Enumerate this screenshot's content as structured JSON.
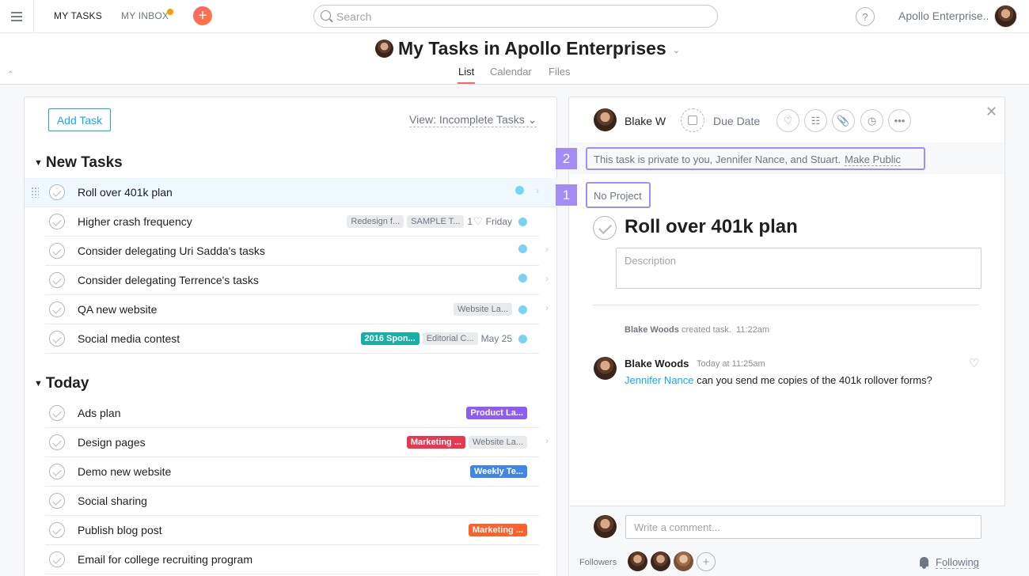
{
  "topbar": {
    "my_tasks": "MY TASKS",
    "my_inbox": "MY INBOX",
    "search_placeholder": "Search",
    "help": "?",
    "workspace": "Apollo Enterprise.."
  },
  "header": {
    "title": "My Tasks in Apollo Enterprises",
    "tabs": {
      "list": "List",
      "calendar": "Calendar",
      "files": "Files"
    }
  },
  "left": {
    "add_task": "Add Task",
    "view_filter": "View: Incomplete Tasks",
    "sections": [
      {
        "title": "New Tasks",
        "tasks": [
          {
            "name": "Roll over 401k plan",
            "tags": [],
            "selected": true,
            "chevron": true,
            "dot": true
          },
          {
            "name": "Higher crash frequency",
            "tags": [
              {
                "text": "Redesign f..."
              },
              {
                "text": "SAMPLE T..."
              }
            ],
            "likes": "1",
            "due": "Friday",
            "dot": true
          },
          {
            "name": "Consider delegating Uri Sadda's tasks",
            "tags": [],
            "chevron": true,
            "dot": true
          },
          {
            "name": "Consider delegating Terrence's tasks",
            "tags": [],
            "chevron": true,
            "dot": true
          },
          {
            "name": "QA new website",
            "tags": [
              {
                "text": "Website La..."
              }
            ],
            "chevron": true,
            "dot": true
          },
          {
            "name": "Social media contest",
            "tags": [
              {
                "text": "2016 Spon...",
                "color": "#1aafa6"
              },
              {
                "text": "Editorial C..."
              }
            ],
            "due": "May 25",
            "dot": true
          }
        ]
      },
      {
        "title": "Today",
        "tasks": [
          {
            "name": "Ads plan",
            "tags": [
              {
                "text": "Product La...",
                "color": "#8d5cf1"
              }
            ]
          },
          {
            "name": "Design pages",
            "tags": [
              {
                "text": "Marketing ...",
                "color": "#e8384f"
              },
              {
                "text": "Website La..."
              }
            ],
            "chevron": true
          },
          {
            "name": "Demo new website",
            "tags": [
              {
                "text": "Weekly Te...",
                "color": "#4186e0"
              }
            ]
          },
          {
            "name": "Social sharing",
            "tags": []
          },
          {
            "name": "Publish blog post",
            "tags": [
              {
                "text": "Marketing ...",
                "color": "#fd612c"
              }
            ]
          },
          {
            "name": "Email for college recruiting program",
            "tags": []
          }
        ]
      }
    ]
  },
  "detail": {
    "assignee": "Blake W",
    "due_date": "Due Date",
    "badge_2": "2",
    "badge_1": "1",
    "privacy_text": "This task is private to you, Jennifer Nance, and Stuart.",
    "make_public": "Make Public",
    "project": "No Project",
    "title": "Roll over 401k plan",
    "description_placeholder": "Description",
    "activity_author": "Blake Woods",
    "activity_text": "created task.",
    "activity_time": "11:22am",
    "comment_author": "Blake Woods",
    "comment_time": "Today at 11:25am",
    "comment_mention": "Jennifer Nance",
    "comment_text": "can you send me copies of the 401k rollover forms?",
    "comment_placeholder": "Write a comment...",
    "followers_label": "Followers",
    "following": "Following"
  }
}
